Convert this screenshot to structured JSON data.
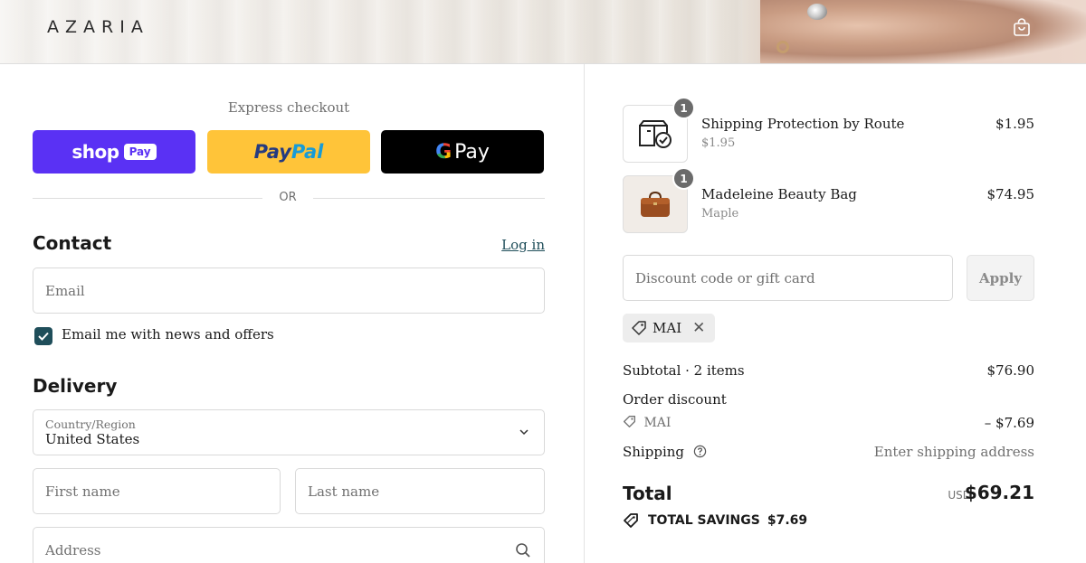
{
  "header": {
    "logo": "AZARIA",
    "cart_icon": "shopping-bag-icon"
  },
  "express": {
    "title": "Express checkout",
    "shoppay_text": "shop",
    "shoppay_badge": "Pay",
    "paypal_part1": "Pay",
    "paypal_part2": "Pal",
    "gpay_g": "G",
    "gpay_text": "Pay",
    "or_label": "OR"
  },
  "contact": {
    "title": "Contact",
    "login_label": "Log in",
    "email_placeholder": "Email",
    "newsletter_label": "Email me with news and offers",
    "newsletter_checked": true
  },
  "delivery": {
    "title": "Delivery",
    "country_label": "Country/Region",
    "country_value": "United States",
    "first_name_placeholder": "First name",
    "last_name_placeholder": "Last name",
    "address_placeholder": "Address"
  },
  "order": {
    "items": [
      {
        "name": "Shipping Protection by Route",
        "sub": "$1.95",
        "price": "$1.95",
        "qty": "1",
        "icon": "package-check-icon"
      },
      {
        "name": "Madeleine Beauty Bag",
        "sub": "Maple",
        "price": "$74.95",
        "qty": "1",
        "icon": "bag-thumbnail"
      }
    ],
    "discount_placeholder": "Discount code or gift card",
    "apply_label": "Apply",
    "applied_code": "MAI",
    "subtotal_label": "Subtotal · 2 items",
    "subtotal_value": "$76.90",
    "order_discount_label": "Order discount",
    "discount_code": "MAI",
    "discount_value": "– $7.69",
    "shipping_label": "Shipping",
    "shipping_value": "Enter shipping address",
    "total_label": "Total",
    "currency": "USD",
    "total_value": "$69.21",
    "savings_label": "TOTAL SAVINGS",
    "savings_value": "$7.69"
  },
  "colors": {
    "accent": "#1f4e5a",
    "shoppay": "#5a31f4",
    "paypal": "#ffc439",
    "gpay": "#000000"
  }
}
